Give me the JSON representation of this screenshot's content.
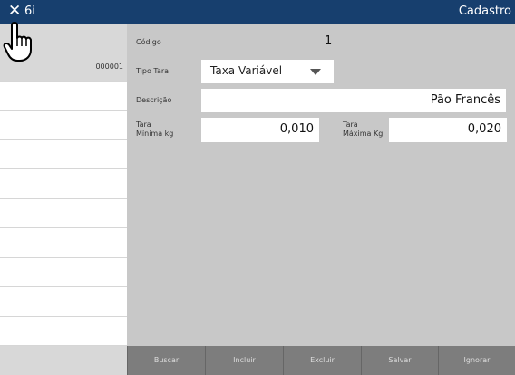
{
  "titlebar": {
    "close_glyph": "✕",
    "app_code": "6i",
    "screen_title": "Cadastro"
  },
  "sidebar": {
    "items": [
      {
        "code": ""
      },
      {
        "code": "000001"
      },
      {
        "code": ""
      },
      {
        "code": ""
      },
      {
        "code": ""
      },
      {
        "code": ""
      },
      {
        "code": ""
      },
      {
        "code": ""
      },
      {
        "code": ""
      },
      {
        "code": ""
      },
      {
        "code": ""
      }
    ]
  },
  "form": {
    "codigo_label": "Código",
    "codigo_value": "1",
    "tipo_tara_label": "Tipo Tara",
    "tipo_tara_value": "Taxa Variável",
    "descricao_label": "Descrição",
    "descricao_value": "Pão Francês",
    "tara_min_label_1": "Tara",
    "tara_min_label_2": "Mínima kg",
    "tara_min_value": "0,010",
    "tara_max_label_1": "Tara",
    "tara_max_label_2": "Máxima Kg",
    "tara_max_value": "0,020"
  },
  "toolbar": {
    "buscar": "Buscar",
    "incluir": "Incluir",
    "excluir": "Excluir",
    "salvar": "Salvar",
    "ignorar": "Ignorar"
  },
  "colors": {
    "titlebar": "#173f6e",
    "panel": "#c8c8c8",
    "toolbar": "#7d7d7d"
  },
  "icons": {
    "pointer": "hand-pointer-icon",
    "close": "close-icon",
    "dropdown": "chevron-down-icon"
  }
}
